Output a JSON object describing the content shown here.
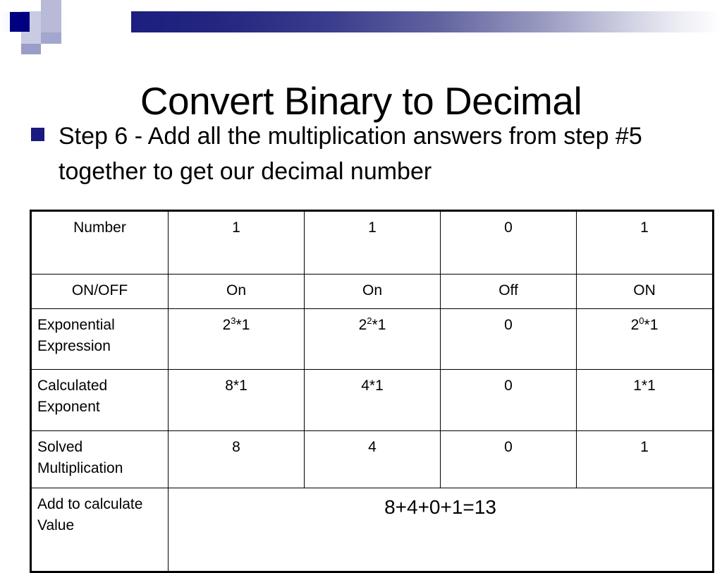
{
  "slide": {
    "title": "Convert Binary to Decimal",
    "bullet": "Step 6 - Add all the multiplication answers from step #5 together to get our decimal number",
    "accent_color": "#000080",
    "bullet_marker_color": "#1a1a80"
  },
  "table": {
    "rows": [
      {
        "label": "Number",
        "label_align": "center",
        "cells": [
          "1",
          "1",
          "0",
          "1"
        ]
      },
      {
        "label": "ON/OFF",
        "label_align": "center",
        "cells": [
          "On",
          "On",
          "Off",
          "ON"
        ]
      },
      {
        "label": "Exponential Expression",
        "label_align": "left",
        "cells_html": [
          "2<sup>3</sup>*1",
          "2<sup>2</sup>*1",
          "0",
          "2<sup>0</sup>*1"
        ],
        "cells": [
          "2^3*1",
          "2^2*1",
          "0",
          "2^0*1"
        ]
      },
      {
        "label": "Calculated Exponent",
        "label_align": "left",
        "cells": [
          "8*1",
          "4*1",
          "0",
          "1*1"
        ]
      },
      {
        "label": "Solved Multiplication",
        "label_align": "left",
        "cells": [
          "8",
          "4",
          "0",
          "1"
        ]
      },
      {
        "label": "Add to calculate Value",
        "label_align": "left",
        "span_value": "8+4+0+1=13"
      }
    ]
  }
}
